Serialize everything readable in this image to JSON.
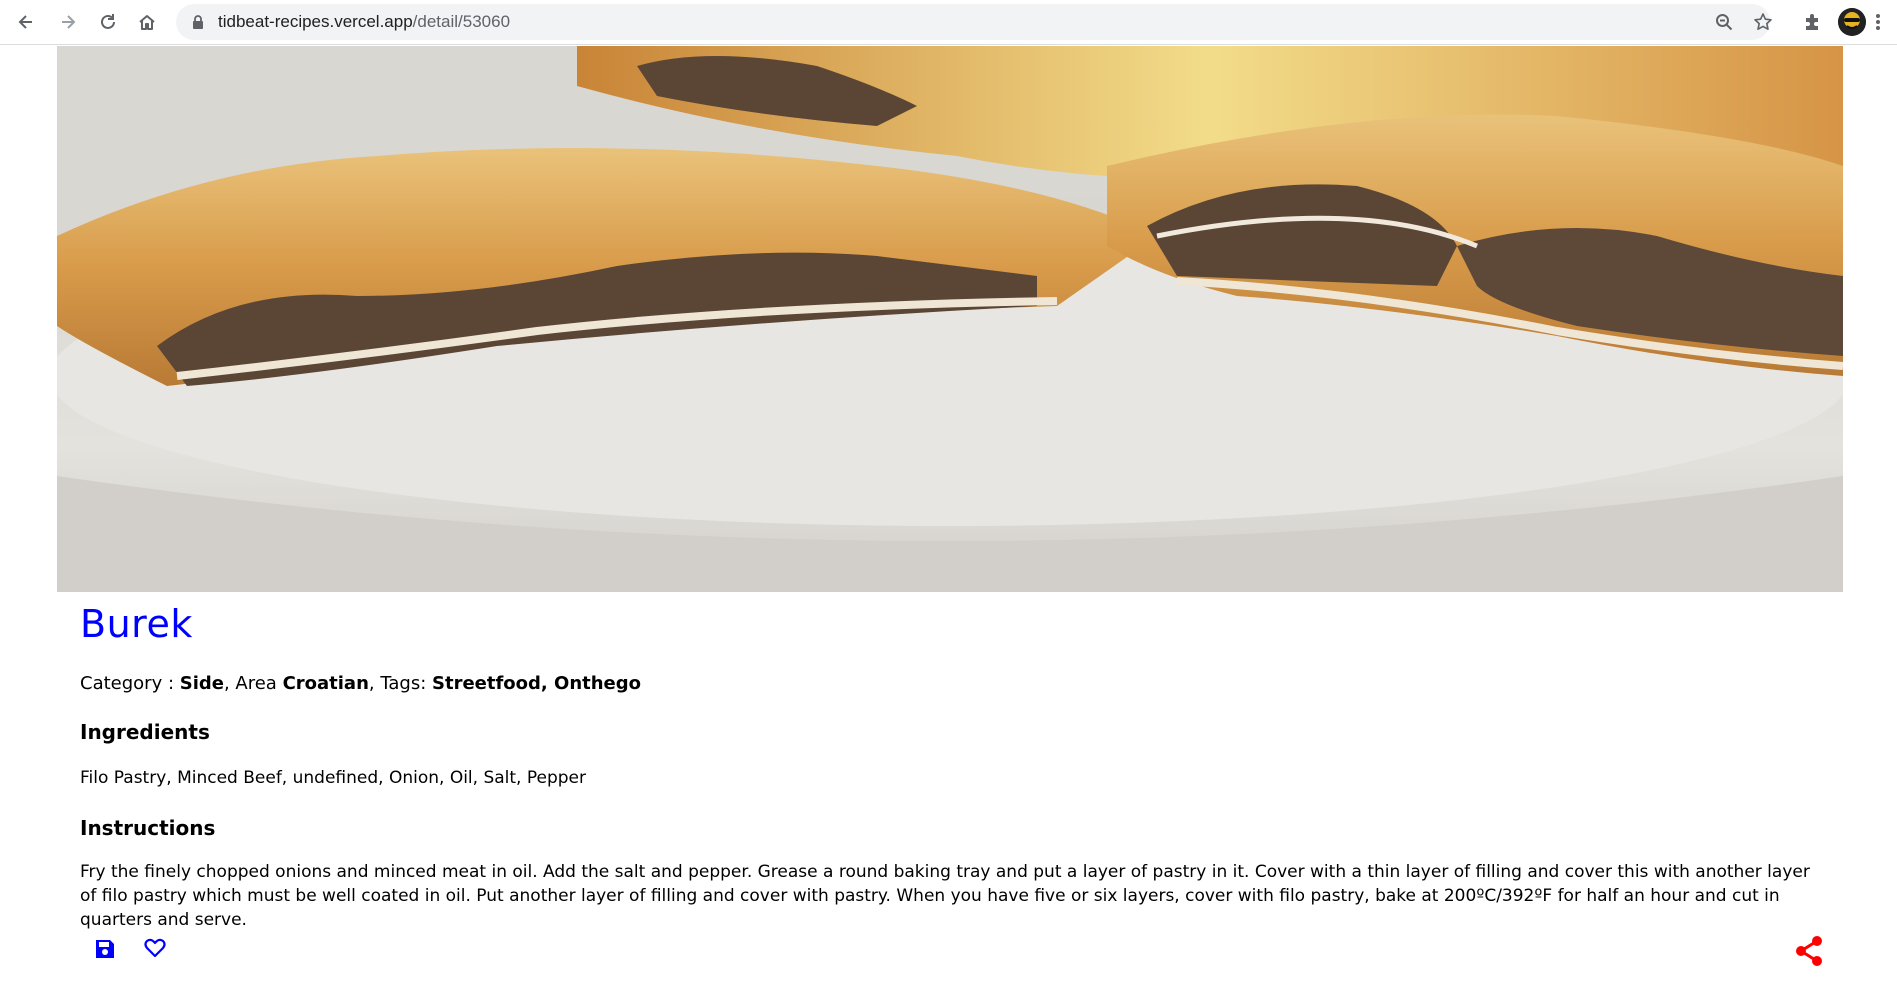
{
  "browser": {
    "url_host": "tidbeat-recipes.vercel.app",
    "url_path": "/detail/53060",
    "icons": [
      "back-icon",
      "forward-icon",
      "reload-icon",
      "home-icon",
      "lock-icon",
      "zoom-icon",
      "star-icon",
      "extensions-icon",
      "avatar",
      "menu-icon"
    ]
  },
  "recipe": {
    "title": "Burek",
    "category_label": "Category : ",
    "category": "Side",
    "area_label": ", Area ",
    "area": "Croatian",
    "tags_label": ", Tags: ",
    "tags": "Streetfood, Onthego",
    "ingredients_heading": "Ingredients",
    "ingredients": "Filo Pastry, Minced Beef, undefined, Onion, Oil, Salt, Pepper",
    "instructions_heading": "Instructions",
    "instructions": "Fry the finely chopped onions and minced meat in oil. Add the salt and pepper. Grease a round baking tray and put a layer of pastry in it. Cover with a thin layer of filling and cover this with another layer of filo pastry which must be well coated in oil. Put another layer of filling and cover with pastry. When you have five or six layers, cover with filo pastry, bake at 200ºC/392ºF for half an hour and cut in quarters and serve."
  },
  "actions": {
    "icons": [
      "save-icon",
      "heart-icon",
      "share-icon"
    ]
  },
  "colors": {
    "title": "#0000ff",
    "save": "#0000ff",
    "share": "#ff0000"
  }
}
